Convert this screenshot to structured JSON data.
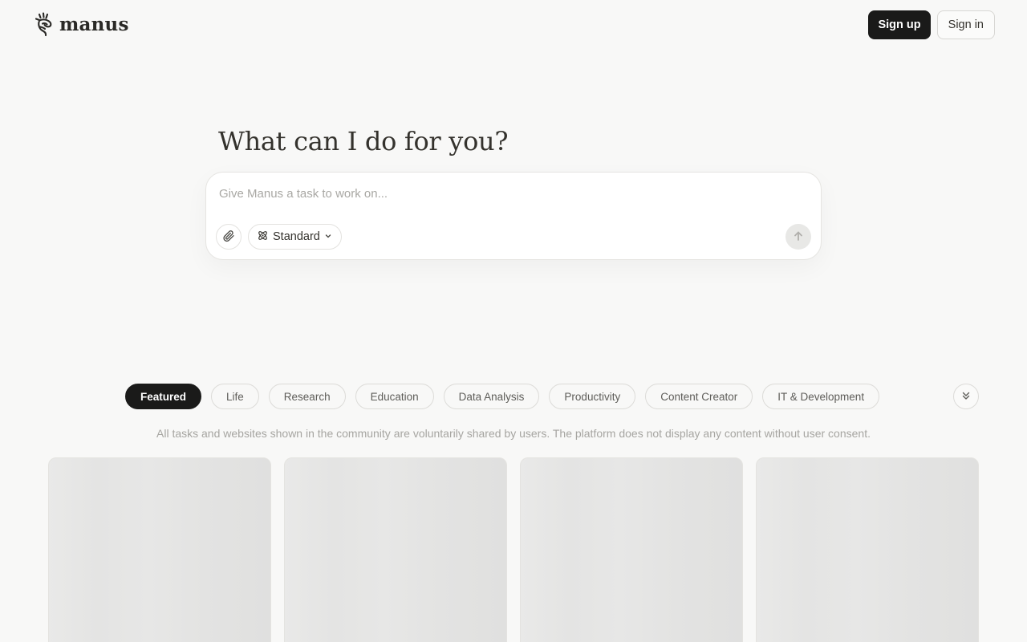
{
  "brand": {
    "name": "manus",
    "logo_icon": "manus-hand-icon"
  },
  "auth": {
    "signup_label": "Sign up",
    "signin_label": "Sign in"
  },
  "hero": {
    "title": "What can I do for you?",
    "input_placeholder": "Give Manus a task to work on...",
    "input_value": "",
    "mode_label": "Standard",
    "mode_icon": "atom-icon",
    "attach_icon": "paperclip-icon",
    "send_icon": "arrow-up-icon"
  },
  "categories": {
    "items": [
      {
        "label": "Featured",
        "active": true
      },
      {
        "label": "Life",
        "active": false
      },
      {
        "label": "Research",
        "active": false
      },
      {
        "label": "Education",
        "active": false
      },
      {
        "label": "Data Analysis",
        "active": false
      },
      {
        "label": "Productivity",
        "active": false
      },
      {
        "label": "Content Creator",
        "active": false
      },
      {
        "label": "IT & Development",
        "active": false
      }
    ],
    "expand_icon": "double-chevron-down-icon"
  },
  "disclaimer": "All tasks and websites shown in the community are voluntarily shared by users. The platform does not display any content without user consent.",
  "cards": {
    "count": 4,
    "state": "loading"
  },
  "colors": {
    "background": "#f8f8f7",
    "primary_button": "#1a1a19",
    "text": "#34322d",
    "muted_text": "#a6a5a1",
    "card_placeholder": "#e6e6e5"
  }
}
